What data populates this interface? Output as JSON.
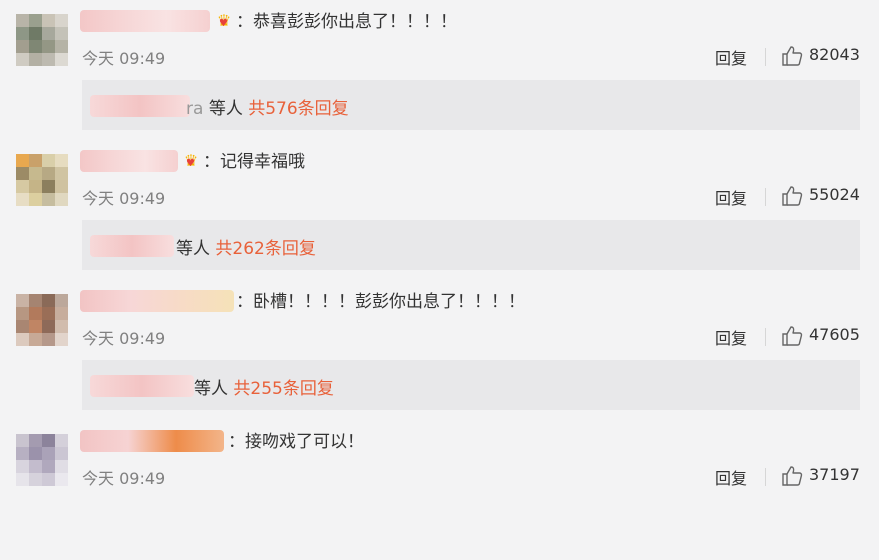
{
  "comments": [
    {
      "text": "：恭喜彭彭你出息了！！！！",
      "time": "今天 09:49",
      "reply_label": "回复",
      "likes": "82043",
      "replies_partial_name": "ra",
      "replies_who": "等人",
      "replies_count": "共576条回复"
    },
    {
      "text": "：记得幸福哦",
      "time": "今天 09:49",
      "reply_label": "回复",
      "likes": "55024",
      "replies_who": "等人",
      "replies_count": "共262条回复"
    },
    {
      "text": "：卧槽！！！！彭彭你出息了！！！！",
      "time": "今天 09:49",
      "reply_label": "回复",
      "likes": "47605",
      "replies_who": "等人",
      "replies_count": "共255条回复"
    },
    {
      "text": "：接吻戏了可以！",
      "time": "今天 09:49",
      "reply_label": "回复",
      "likes": "37197"
    }
  ],
  "colors": {
    "accent": "#e8613a",
    "background": "#f3f3f4",
    "reply_box": "#e8e8ea",
    "muted_text": "#808080"
  },
  "icons": {
    "like": "thumbs-up-icon",
    "badge": "crown-heart-icon"
  }
}
